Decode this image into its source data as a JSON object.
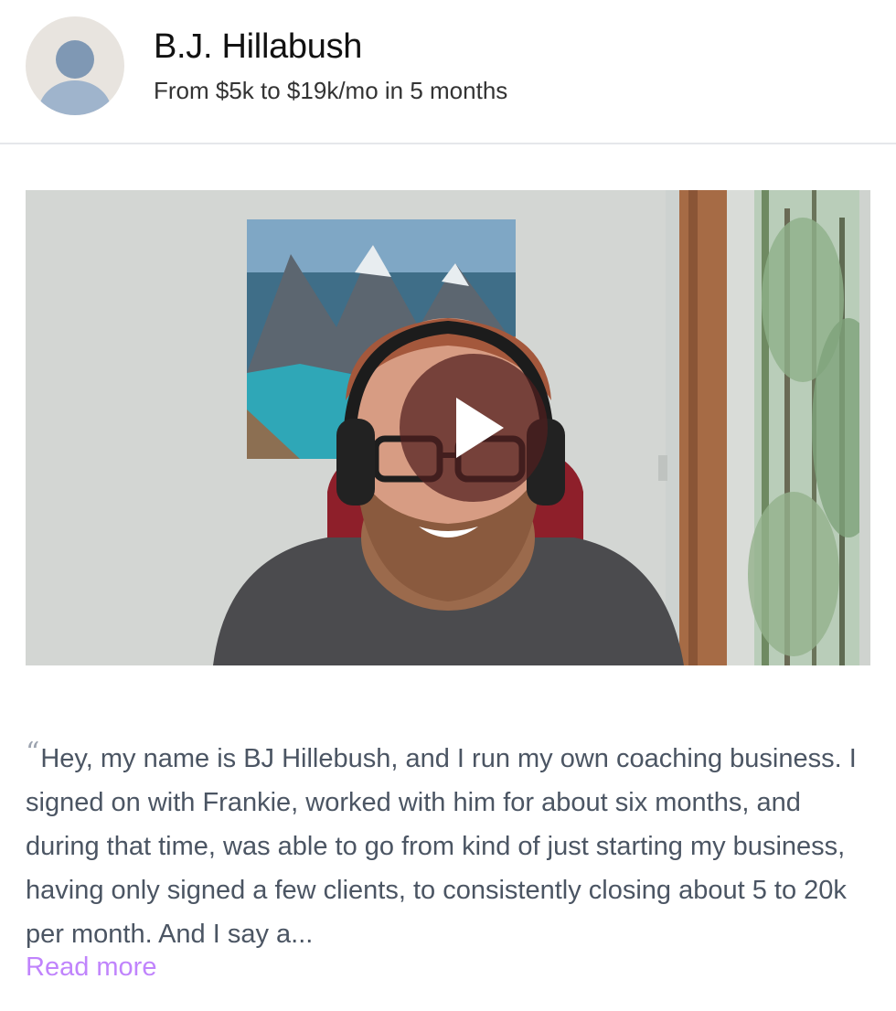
{
  "profile": {
    "name": "B.J. Hillabush",
    "tagline": "From $5k to $19k/mo in 5 months",
    "avatar_icon": "user-avatar-icon"
  },
  "video": {
    "play_icon": "play-icon",
    "thumbnail": "man-with-headphones-video-thumbnail"
  },
  "testimonial": {
    "open_quote": "“",
    "text": "Hey, my name is BJ Hillebush, and I run my own coaching business. I signed on with Frankie, worked with him for about six months, and during that time, was able to go from kind of just starting my business, having only signed a few clients, to consistently closing about 5 to 20k per month. And I say a...",
    "read_more_label": "Read more"
  },
  "colors": {
    "link": "#c084fc",
    "body_text": "#4b5563",
    "divider": "#e5e7eb",
    "play_overlay": "#501e1e"
  }
}
